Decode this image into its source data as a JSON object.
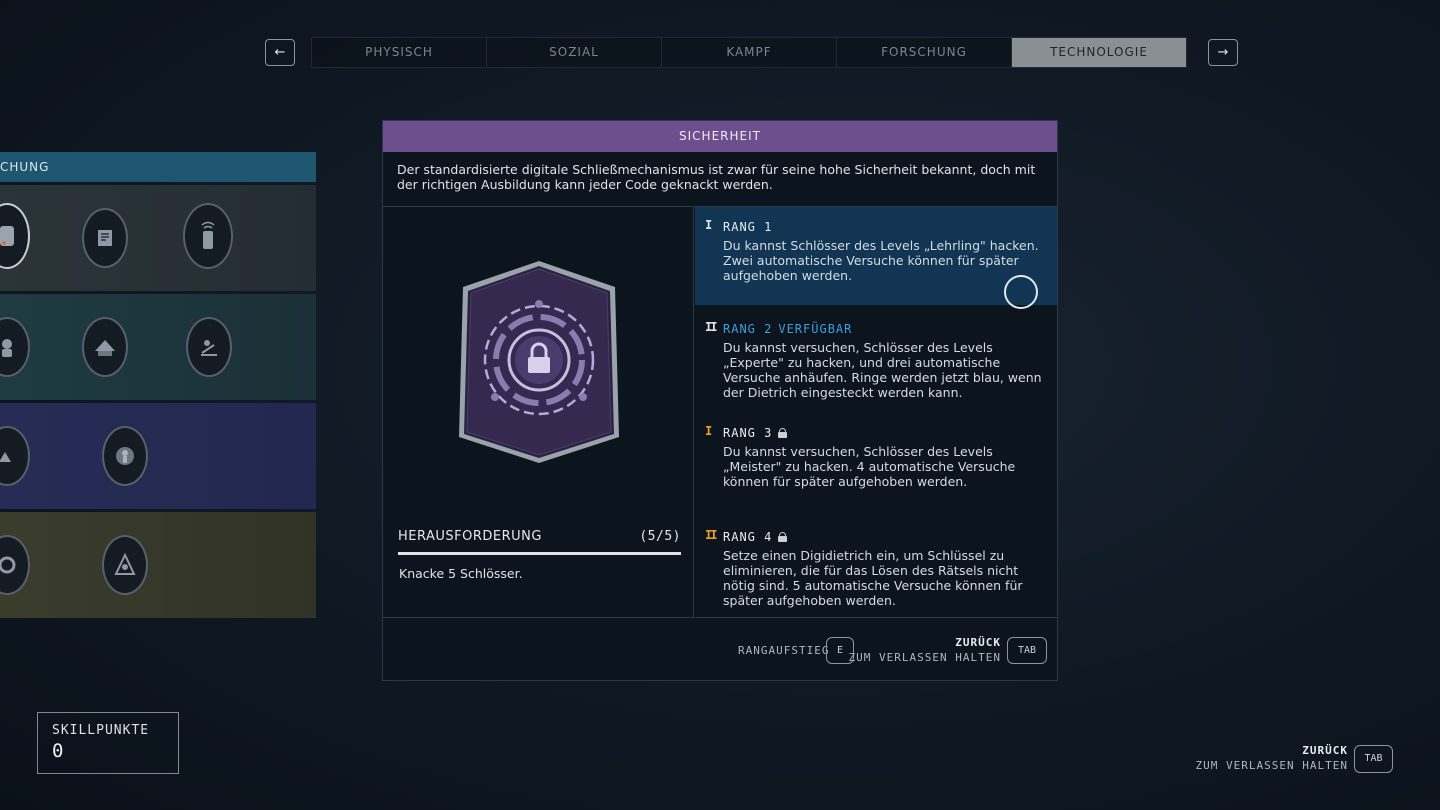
{
  "tabs": {
    "prev_arrow": "←",
    "next_arrow": "→",
    "items": [
      "PHYSISCH",
      "SOZIAL",
      "KAMPF",
      "FORSCHUNG",
      "TECHNOLOGIE"
    ],
    "active_index": 4
  },
  "tree": {
    "header": "CHUNG",
    "row_colors": [
      "#2b3439",
      "#1f3b42",
      "#262c55",
      "#3a3c2c"
    ]
  },
  "panel": {
    "title": "SICHERHEIT",
    "description": "Der standardisierte digitale Schließmechanismus ist zwar für seine hohe Sicherheit bekannt, doch mit der richtigen Ausbildung kann jeder Code geknackt werden.",
    "challenge": {
      "label": "HERAUSFORDERUNG",
      "progress": "(5/5)",
      "progress_fraction": 1.0,
      "text": "Knacke 5 Schlösser."
    },
    "ranks": [
      {
        "mark": "I",
        "title": "RANG 1",
        "status": "",
        "locked": false,
        "current": true,
        "description": "Du kannst Schlösser des Levels „Lehrling\" hacken. Zwei automatische Versuche können für später aufgehoben werden."
      },
      {
        "mark": "II",
        "title": "RANG 2",
        "status": "VERFÜGBAR",
        "locked": false,
        "current": false,
        "description": "Du kannst versuchen, Schlösser des Levels „Experte\" zu hacken, und drei automatische Versuche anhäufen. Ringe werden jetzt blau, wenn der Dietrich eingesteckt werden kann."
      },
      {
        "mark": "I",
        "title": "RANG 3",
        "status": "",
        "locked": true,
        "current": false,
        "description": "Du kannst versuchen, Schlösser des Levels „Meister\" zu hacken. 4 automatische Versuche können für später aufgehoben werden."
      },
      {
        "mark": "II",
        "title": "RANG 4",
        "status": "",
        "locked": true,
        "current": false,
        "description": "Setze einen Digidietrich ein, um Schlüssel zu eliminieren, die für das Lösen des Rätsels nicht nötig sind. 5 automatische Versuche können für später aufgehoben werden."
      }
    ],
    "footer": {
      "rank_up_label": "RANGAUFSTIEG",
      "rank_up_key": "E",
      "back_label": "ZURÜCK",
      "back_sub": "ZUM VERLASSEN HALTEN",
      "back_key": "TAB"
    }
  },
  "skillpoints": {
    "label": "SKILLPUNKTE",
    "value": "0"
  },
  "global_back": {
    "label": "ZURÜCK",
    "sub": "ZUM VERLASSEN HALTEN",
    "key": "TAB"
  },
  "colors": {
    "title_bar": "#6c4f8c",
    "current_rank": "#113552",
    "available": "#3e9fe0",
    "locked_mark": "#e8a21e",
    "unlocked_mark": "#dfe4e8"
  }
}
